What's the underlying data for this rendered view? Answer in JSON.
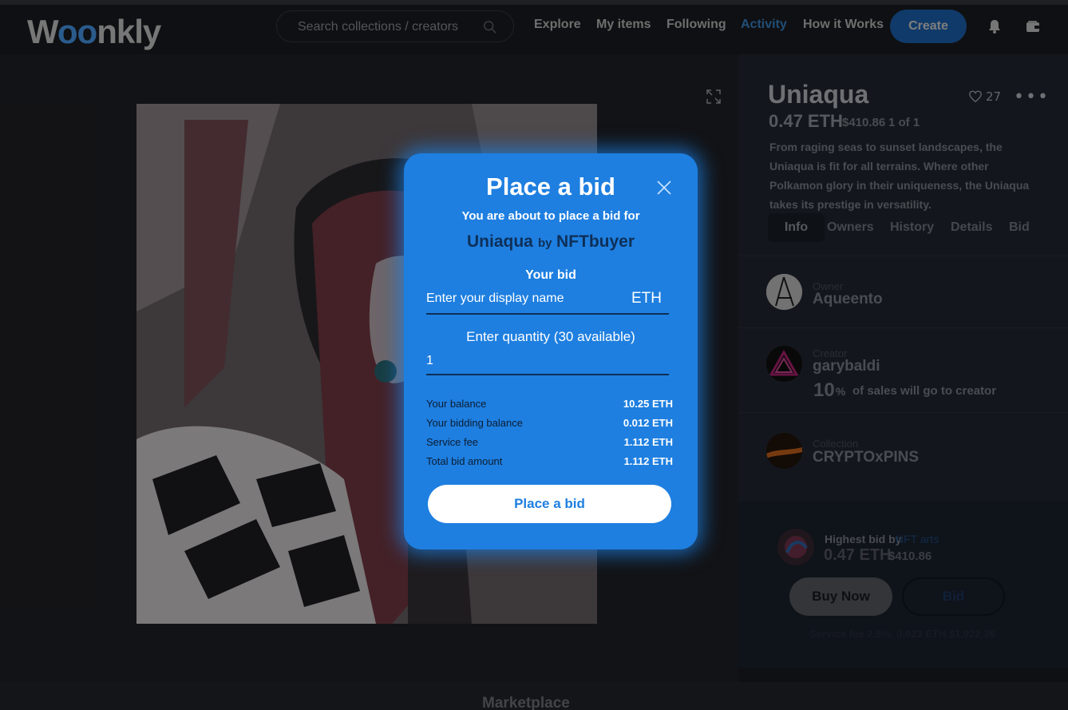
{
  "header": {
    "logo_text": "Woonkly",
    "search_placeholder": "Search collections / creators",
    "nav": [
      "Explore",
      "My items",
      "Following",
      "Activity",
      "How it Works"
    ],
    "active_nav": "Activity",
    "create_label": "Create"
  },
  "item": {
    "title": "Uniaqua",
    "likes": "27",
    "price_eth": "0.47 ETH",
    "price_usd": "$410.86",
    "edition": "1 of 1",
    "description": "From raging seas to sunset landscapes, the Uniaqua is fit for all terrains. Where other Polkamon glory in their uniqueness, the Uniaqua takes its prestige in versatility.",
    "tabs": [
      "Info",
      "Owners",
      "History",
      "Details",
      "Bid"
    ],
    "active_tab": "Info"
  },
  "people": {
    "owner_role": "Owner",
    "owner_name": "Aqueento",
    "creator_role": "Creator",
    "creator_name": "garybaldi",
    "royalty_num": "10",
    "royalty_pct": "%",
    "royalty_text": "of sales will go to creator",
    "collection_role": "Collection",
    "collection_name": "CRYPTOxPINS"
  },
  "highest_bid": {
    "label": "Highest bid by",
    "user": "NFT arts",
    "eth": "0.47 ETH",
    "usd": "$410.86",
    "buy_label": "Buy Now",
    "bid_label": "Bid",
    "fee_line": "Service fee 2.5%. 0.923 ETH  $1,922.36"
  },
  "footer": {
    "label": "Marketplace"
  },
  "modal": {
    "title": "Place a bid",
    "subtitle": "You are about to place a bid for",
    "item_name": "Uniaqua",
    "by": "by",
    "creator": "NFTbuyer",
    "your_bid_label": "Your bid",
    "bid_placeholder": "Enter your display name",
    "unit": "ETH",
    "qty_label": "Enter quantity (30 available)",
    "qty_value": "1",
    "rows": [
      {
        "k": "Your balance",
        "v": "10.25 ETH"
      },
      {
        "k": "Your bidding balance",
        "v": "0.012 ETH"
      },
      {
        "k": "Service fee",
        "v": "1.112 ETH"
      },
      {
        "k": "Total bid amount",
        "v": "1.112 ETH"
      }
    ],
    "button_label": "Place a bid"
  }
}
